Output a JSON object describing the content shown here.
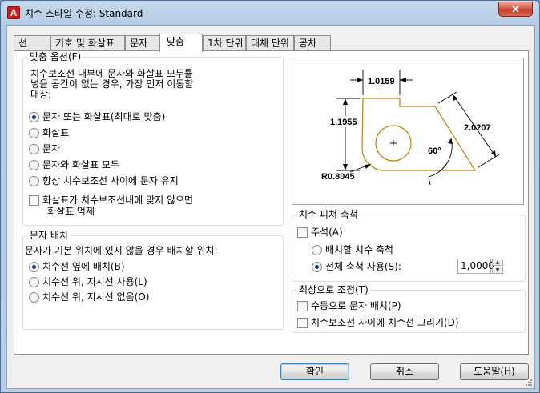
{
  "window": {
    "title": "치수 스타일 수정: Standard",
    "app_icon": "A",
    "close_symbol": "✕"
  },
  "tabs": [
    {
      "label": "선"
    },
    {
      "label": "기호 및 화살표"
    },
    {
      "label": "문자"
    },
    {
      "label": "맞춤",
      "active": true
    },
    {
      "label": "1차 단위"
    },
    {
      "label": "대체 단위"
    },
    {
      "label": "공차"
    }
  ],
  "fit_options": {
    "title": "맞춤 옵션(F)",
    "description": [
      "치수보조선 내부에 문자와 화살표 모두를",
      "넣을 공간이 없는 경우, 가장 먼저 이동할",
      "대상:"
    ],
    "radios": [
      {
        "label": "문자 또는 화살표(최대로 맞춤)",
        "checked": true
      },
      {
        "label": "화살표",
        "checked": false
      },
      {
        "label": "문자",
        "checked": false
      },
      {
        "label": "문자와 화살표 모두",
        "checked": false
      },
      {
        "label": "항상 치수보조선 사이에 문자 유지",
        "checked": false
      }
    ],
    "suppress_checkbox": {
      "line1": "화살표가 치수보조선내에 맞지 않으면",
      "line2": "화살표 억제",
      "checked": false
    }
  },
  "text_placement": {
    "title": "문자 배치",
    "description": "문자가 기본 위치에 있지 않을 경우 배치할 위치:",
    "radios": [
      {
        "label": "치수선 옆에 배치(B)",
        "checked": true
      },
      {
        "label": "치수선 위, 지시선 사용(L)",
        "checked": false
      },
      {
        "label": "치수선 위, 지시선 없음(O)",
        "checked": false
      }
    ]
  },
  "preview": {
    "dim_top": "1.0159",
    "dim_left": "1.1955",
    "dim_right": "2.0207",
    "angle": "60°",
    "radius": "R0.8045",
    "center_mark": "+",
    "colors": {
      "outline": "#b8860b",
      "dim": "#000000"
    }
  },
  "scale": {
    "title": "치수 피쳐 축척",
    "annotative": {
      "label": "주석(A)",
      "checked": false
    },
    "radios": [
      {
        "label": "배치할 치수 축척",
        "checked": false
      },
      {
        "label": "전체 축척 사용(S):",
        "checked": true
      }
    ],
    "overall_scale_value": "1,0000"
  },
  "fine_tuning": {
    "title": "최상으로 조정(T)",
    "checkboxes": [
      {
        "label": "수동으로 문자 배치(P)",
        "checked": false
      },
      {
        "label": "치수보조선 사이에 치수선 그리기(D)",
        "checked": false
      }
    ]
  },
  "buttons": {
    "ok": "확인",
    "cancel": "취소",
    "help": "도움말(H)"
  }
}
